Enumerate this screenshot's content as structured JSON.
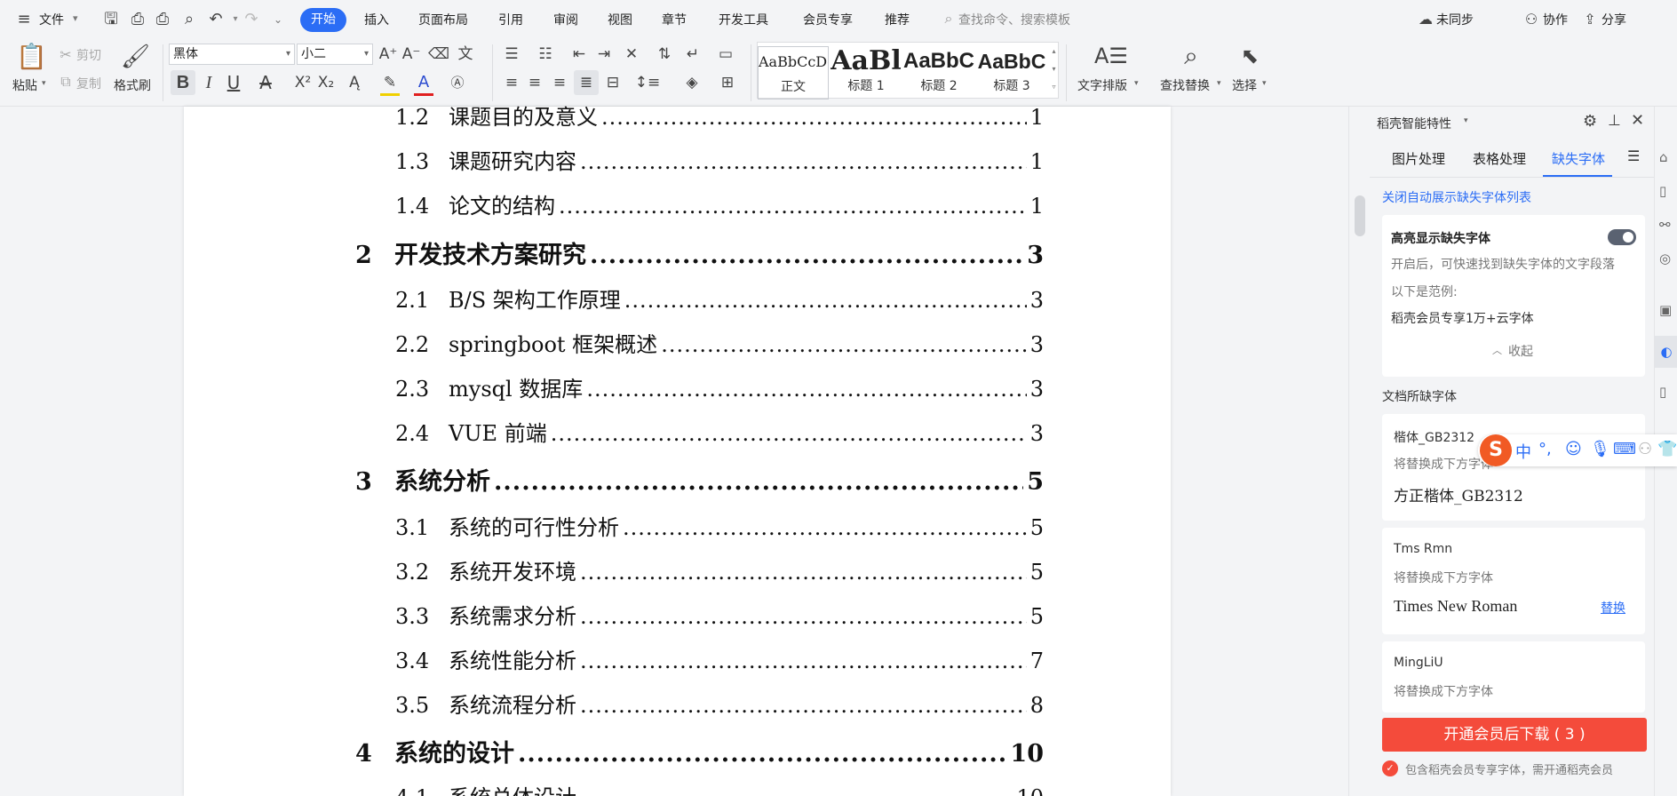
{
  "menubar": {
    "file": "文件",
    "tabs": [
      "开始",
      "插入",
      "页面布局",
      "引用",
      "审阅",
      "视图",
      "章节",
      "开发工具",
      "会员专享",
      "推荐"
    ],
    "search_placeholder": "查找命令、搜索模板",
    "not_synced": "未同步",
    "collaborate": "协作",
    "share": "分享"
  },
  "ribbon": {
    "paste": "粘贴",
    "cut": "剪切",
    "copy": "复制",
    "format_painter": "格式刷",
    "font_name": "黑体",
    "font_size": "小二",
    "styles": [
      {
        "preview": "AaBbCcDd",
        "label": "正文"
      },
      {
        "preview": "AaBl",
        "label": "标题 1"
      },
      {
        "preview": "AaBbC",
        "label": "标题 2"
      },
      {
        "preview": "AaBbC",
        "label": "标题 3"
      }
    ],
    "text_layout": "文字排版",
    "find_replace": "查找替换",
    "select": "选择"
  },
  "document": {
    "toc": [
      {
        "level": 2,
        "num": "1.2",
        "title": "课题目的及意义",
        "page": "1"
      },
      {
        "level": 2,
        "num": "1.3",
        "title": "课题研究内容",
        "page": "1"
      },
      {
        "level": 2,
        "num": "1.4",
        "title": "论文的结构",
        "page": "1"
      },
      {
        "level": 1,
        "num": "2",
        "title": "开发技术方案研究",
        "page": "3"
      },
      {
        "level": 2,
        "num": "2.1",
        "title": "B/S 架构工作原理",
        "page": "3"
      },
      {
        "level": 2,
        "num": "2.2",
        "title": "springboot 框架概述",
        "page": "3"
      },
      {
        "level": 2,
        "num": "2.3",
        "title": "mysql 数据库",
        "page": "3"
      },
      {
        "level": 2,
        "num": "2.4",
        "title": "VUE 前端",
        "page": "3"
      },
      {
        "level": 1,
        "num": "3",
        "title": "系统分析",
        "page": "5"
      },
      {
        "level": 2,
        "num": "3.1",
        "title": "系统的可行性分析",
        "page": "5"
      },
      {
        "level": 2,
        "num": "3.2",
        "title": "系统开发环境",
        "page": "5"
      },
      {
        "level": 2,
        "num": "3.3",
        "title": "系统需求分析",
        "page": "5"
      },
      {
        "level": 2,
        "num": "3.4",
        "title": "系统性能分析",
        "page": "7"
      },
      {
        "level": 2,
        "num": "3.5",
        "title": "系统流程分析",
        "page": "8"
      },
      {
        "level": 1,
        "num": "4",
        "title": "系统的设计",
        "page": "10"
      },
      {
        "level": 2,
        "num": "4.1",
        "title": "系统总体设计",
        "page": "10"
      }
    ]
  },
  "panel": {
    "title": "稻壳智能特性",
    "tabs": [
      "图片处理",
      "表格处理",
      "缺失字体"
    ],
    "active_tab": "缺失字体",
    "close_auto_link": "关闭自动展示缺失字体列表",
    "highlight_title": "高亮显示缺失字体",
    "highlight_desc": "开启后，可快速找到缺失字体的文字段落",
    "example_label": "以下是范例:",
    "example_text": "稻壳会员专享1万+云字体",
    "collapse": "收起",
    "missing_fonts_title": "文档所缺字体",
    "replace_hint": "将替换成下方字体",
    "replace_button": "替换",
    "missing_fonts": [
      {
        "name": "楷体_GB2312",
        "replacement": "方正楷体_GB2312"
      },
      {
        "name": "Tms Rmn",
        "replacement": "Times New Roman"
      },
      {
        "name": "MingLiU",
        "replacement": ""
      }
    ],
    "download_button": "开通会员后下载 ( 3 )",
    "footer_note": "包含稻壳会员专享字体，需开通稻壳会员"
  },
  "ime": {
    "lang": "中",
    "punct": "°,"
  },
  "colors": {
    "accent": "#2b6df5",
    "download": "#f44b3b",
    "link": "#2b6df5"
  }
}
